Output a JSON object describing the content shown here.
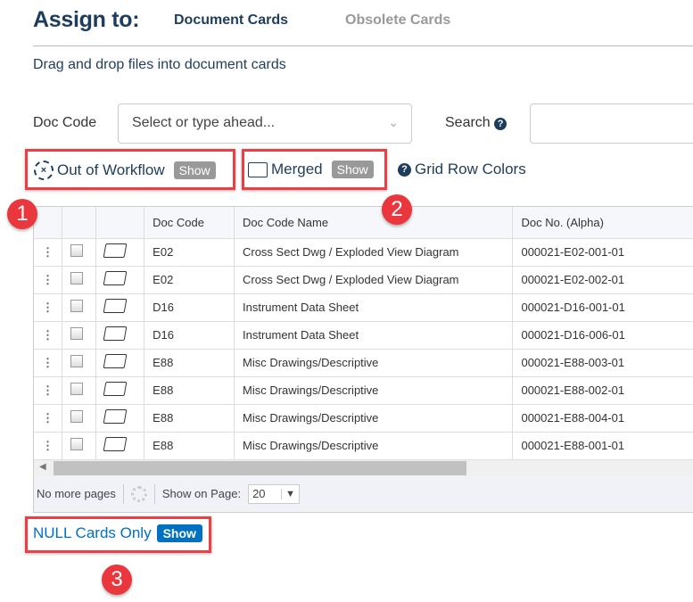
{
  "header": {
    "title": "Assign to:",
    "tabs": [
      {
        "label": "Document Cards"
      },
      {
        "label": "Obsolete Cards"
      }
    ]
  },
  "hint": "Drag and drop files into document cards",
  "filters": {
    "doc_code_label": "Doc Code",
    "doc_code_placeholder": "Select or type ahead...",
    "search_label": "Search",
    "search_value": ""
  },
  "toolbar": {
    "out_of_workflow": "Out of Workflow",
    "merged": "Merged",
    "show": "Show",
    "grid_row_colors": "Grid Row Colors"
  },
  "grid": {
    "columns": [
      "",
      "",
      "",
      "Doc Code",
      "Doc Code Name",
      "Doc No. (Alpha)"
    ],
    "rows": [
      [
        "E02",
        "Cross Sect Dwg / Exploded View Diagram",
        "000021-E02-001-01"
      ],
      [
        "E02",
        "Cross Sect Dwg / Exploded View Diagram",
        "000021-E02-002-01"
      ],
      [
        "D16",
        "Instrument Data Sheet",
        "000021-D16-001-01"
      ],
      [
        "D16",
        "Instrument Data Sheet",
        "000021-D16-006-01"
      ],
      [
        "E88",
        "Misc Drawings/Descriptive",
        "000021-E88-003-01"
      ],
      [
        "E88",
        "Misc Drawings/Descriptive",
        "000021-E88-002-01"
      ],
      [
        "E88",
        "Misc Drawings/Descriptive",
        "000021-E88-004-01"
      ],
      [
        "E88",
        "Misc Drawings/Descriptive",
        "000021-E88-001-01"
      ]
    ],
    "footer": {
      "status": "No more pages",
      "show_on_page_label": "Show on Page:",
      "page_size": "20"
    }
  },
  "null_cards": {
    "label": "NULL Cards Only",
    "button": "Show"
  },
  "annotations": [
    "1",
    "2",
    "3"
  ],
  "colors": {
    "accent": "#0070c0",
    "title": "#1e3d5c",
    "annotation": "#e9373d"
  }
}
